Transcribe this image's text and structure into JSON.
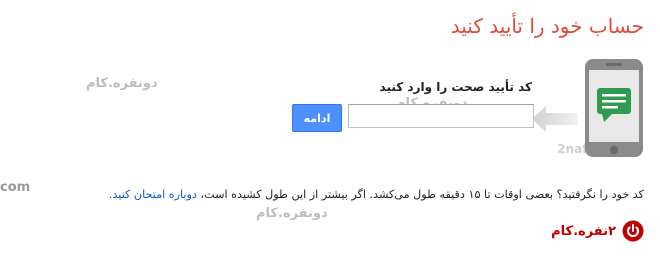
{
  "title": "حساب خود را تأیید کنید",
  "form": {
    "label": "کد تأیید صحت را وارد کنید",
    "code_value": "",
    "continue_label": "ادامه"
  },
  "note": {
    "text": "کد خود را نگرفتید؟ بعضی اوقات تا ۱۵ دقیقه طول می‌کشد. اگر بیشتر از این طول کشیده است، ",
    "link": "دوباره امتحان کنید."
  },
  "watermarks": {
    "fa": "دونفره.کام",
    "en_site": "2nafare.com",
    "en_partial": "com"
  },
  "logo": {
    "text": "۲نفره.کام"
  },
  "colors": {
    "title": "#dd4b39",
    "button": "#4d90fe",
    "link": "#1155cc",
    "logo": "#c00000"
  },
  "icons": {
    "phone": "phone-icon",
    "chat": "chat-bubble-icon",
    "arrow": "arrow-left-icon",
    "logo": "power-logo-icon"
  }
}
